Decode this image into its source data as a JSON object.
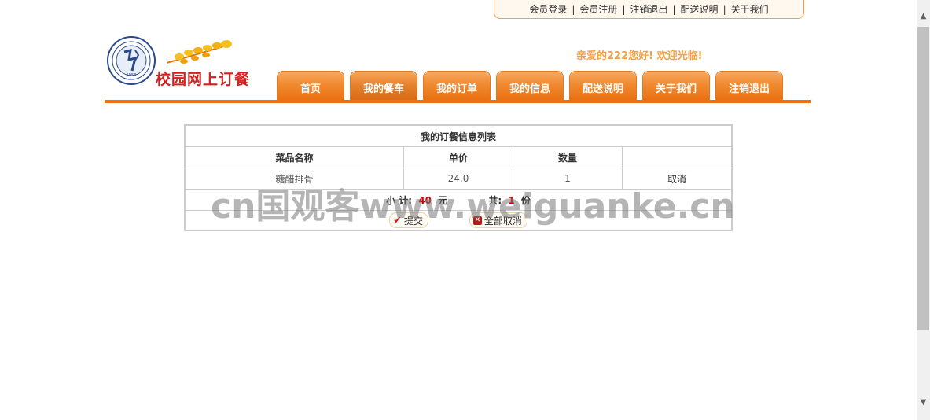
{
  "top_links": [
    "会员登录",
    "会员注册",
    "注销退出",
    "配送说明",
    "关于我们"
  ],
  "top_separator": "|",
  "logo": {
    "text": "校园网上订餐",
    "seal_year": "1958"
  },
  "welcome": "亲爱的222您好!  欢迎光临!",
  "nav_tabs": [
    "首页",
    "我的餐车",
    "我的订单",
    "我的信息",
    "配送说明",
    "关于我们",
    "注销退出"
  ],
  "nav_active": "我的餐车",
  "order_table": {
    "title": "我的订餐信息列表",
    "headers": [
      "菜品名称",
      "单价",
      "数量",
      ""
    ],
    "rows": [
      {
        "name": "糖醋排骨",
        "price": "24.0",
        "qty": "1",
        "action": "取消"
      }
    ],
    "subtotal_label": "小 计:",
    "subtotal_value": "40",
    "subtotal_unit": "元",
    "count_label": "共:",
    "count_value": "1",
    "count_unit": "份",
    "submit_label": "提交",
    "cancel_all_label": "全部取消"
  },
  "watermark": "cn国观客www.weiguanke.cn",
  "colors": {
    "accent_orange": "#ee7016",
    "welcome": "#f5a040",
    "logo_red": "#d42020",
    "price_red": "#d00000"
  }
}
